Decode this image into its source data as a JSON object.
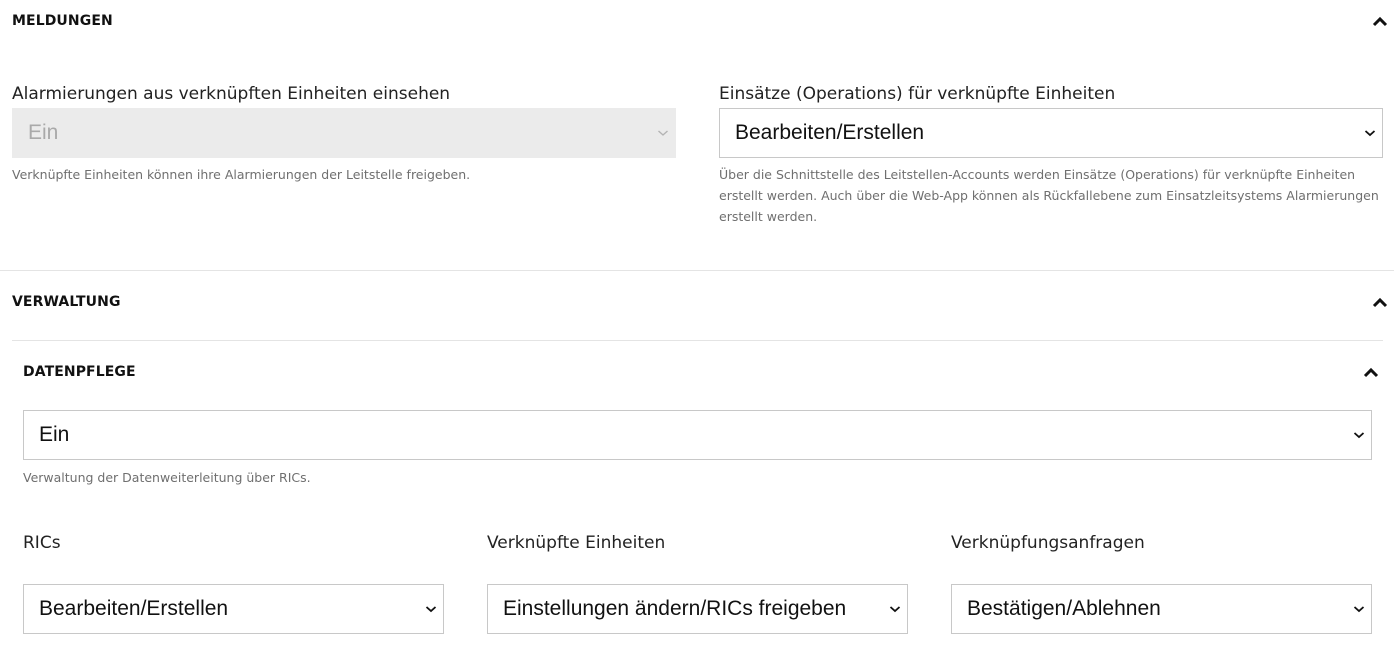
{
  "meldungen": {
    "title": "MELDUNGEN",
    "alarm_view": {
      "label": "Alarmierungen aus verknüpften Einheiten einsehen",
      "value": "Ein",
      "disabled": true,
      "help": "Verknüpfte Einheiten können ihre Alarmierungen der Leitstelle freigeben."
    },
    "operations": {
      "label": "Einsätze (Operations) für verknüpfte Einheiten",
      "value": "Bearbeiten/Erstellen",
      "help": "Über die Schnittstelle des Leitstellen-Accounts werden Einsätze (Operations) für verknüpfte Einheiten erstellt werden. Auch über die Web-App können als Rückfallebene zum Einsatzleitsystems Alarmierungen erstellt werden."
    }
  },
  "verwaltung": {
    "title": "VERWALTUNG",
    "datenpflege": {
      "title": "DATENPFLEGE",
      "value": "Ein",
      "help": "Verwaltung der Datenweiterleitung über RICs."
    },
    "rics": {
      "label": "RICs",
      "value": "Bearbeiten/Erstellen"
    },
    "units": {
      "label": "Verknüpfte Einheiten",
      "value": "Einstellungen ändern/RICs freigeben"
    },
    "requests": {
      "label": "Verknüpfungsanfragen",
      "value": "Bestätigen/Ablehnen"
    }
  },
  "icons": {
    "collapse": "chevron-up-icon",
    "dropdown": "chevron-down-icon"
  }
}
